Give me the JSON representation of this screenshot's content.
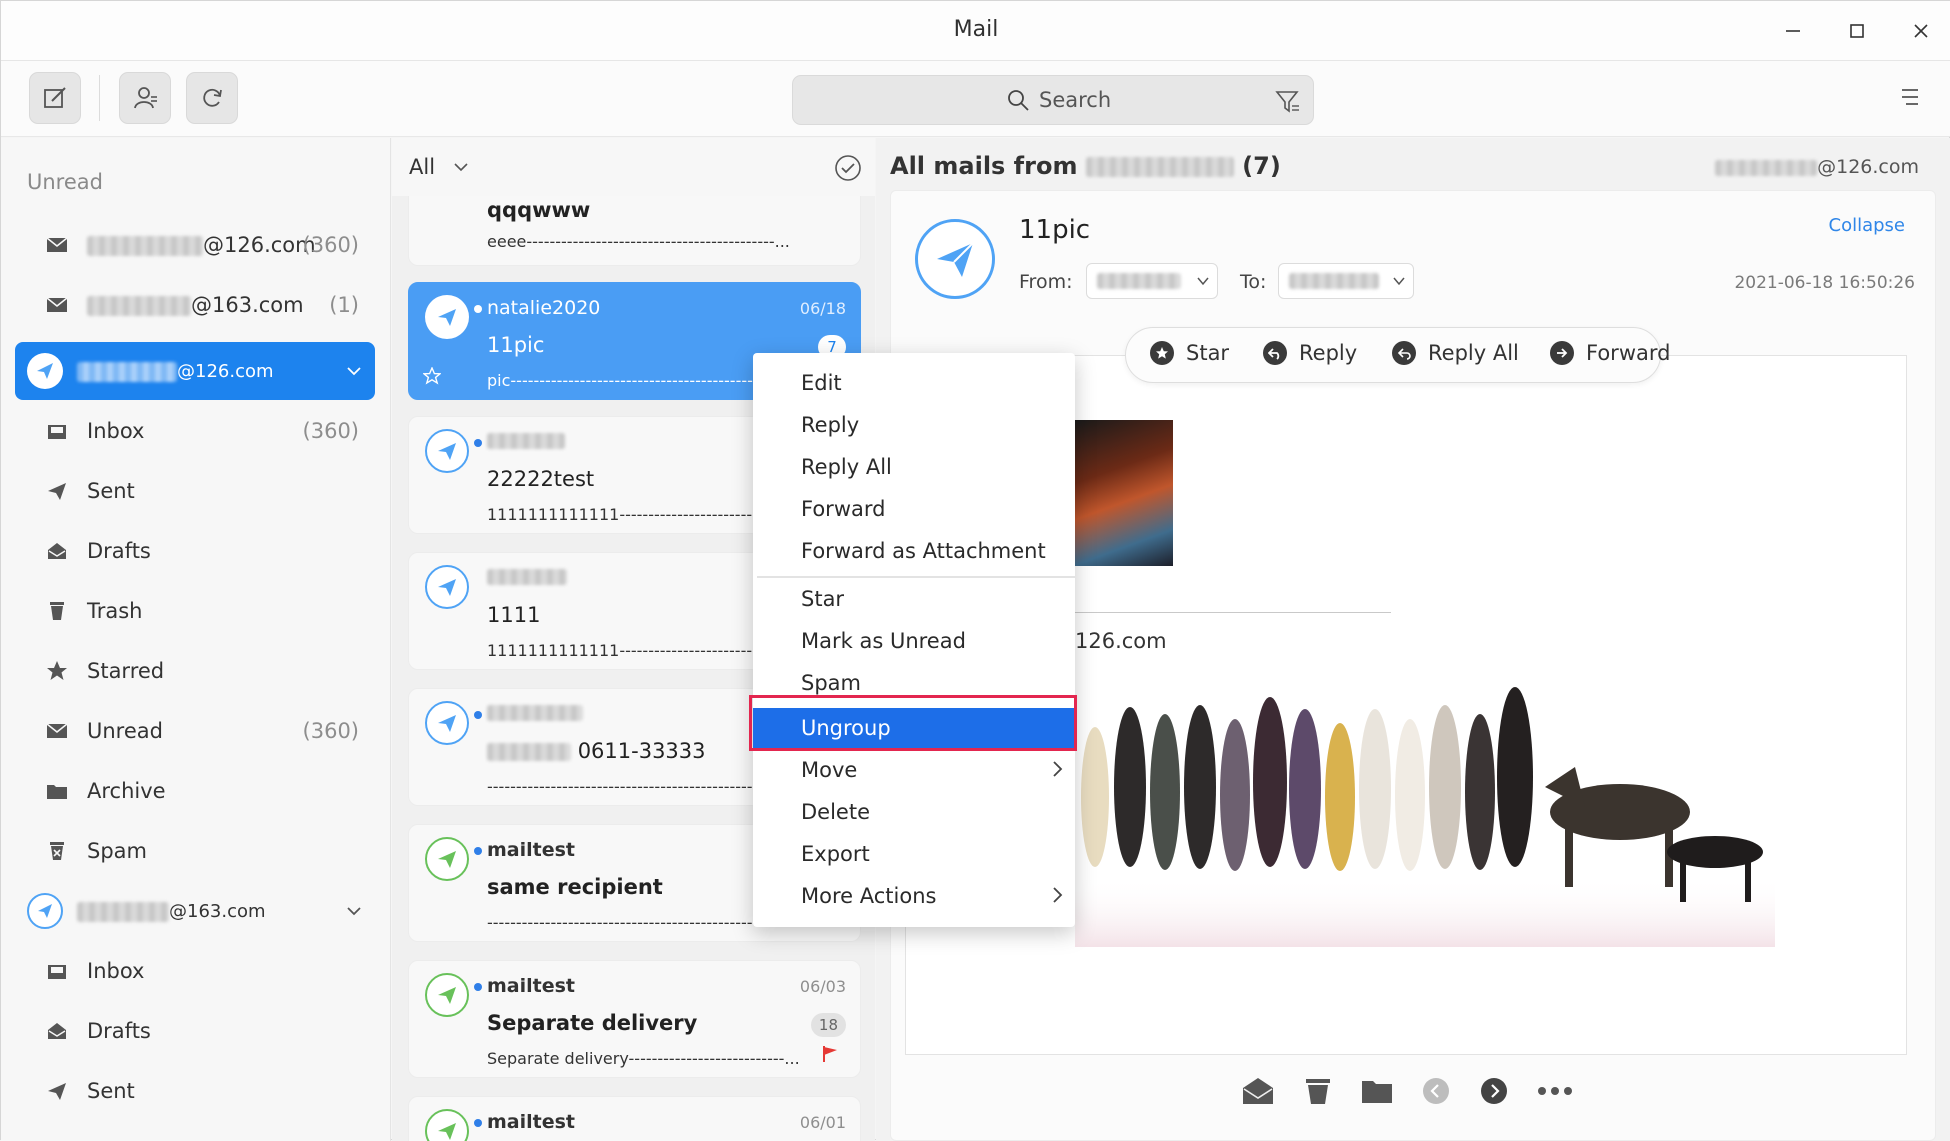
{
  "window": {
    "title": "Mail"
  },
  "toolbar": {
    "search_placeholder": "Search"
  },
  "sidebar": {
    "section_label": "Unread",
    "unread_accounts": [
      {
        "suffix": "@126.com",
        "count": "(360)"
      },
      {
        "suffix": "@163.com",
        "count": "(1)"
      }
    ],
    "account1": {
      "suffix": "@126.com",
      "folders": [
        {
          "label": "Inbox",
          "count": "(360)"
        },
        {
          "label": "Sent",
          "count": ""
        },
        {
          "label": "Drafts",
          "count": ""
        },
        {
          "label": "Trash",
          "count": ""
        },
        {
          "label": "Starred",
          "count": ""
        },
        {
          "label": "Unread",
          "count": "(360)"
        },
        {
          "label": "Archive",
          "count": ""
        },
        {
          "label": "Spam",
          "count": ""
        }
      ]
    },
    "account2": {
      "suffix": "@163.com",
      "folders": [
        {
          "label": "Inbox"
        },
        {
          "label": "Drafts"
        },
        {
          "label": "Sent"
        }
      ]
    }
  },
  "maillist": {
    "filter": "All",
    "items": [
      {
        "from": "",
        "subject": "qqqwww",
        "preview": "eeee-------------------------------------------...",
        "date": "",
        "count": ""
      },
      {
        "from": "natalie2020",
        "subject": "11pic",
        "preview": "pic-------------------------------------------------...",
        "date": "06/18",
        "count": "7"
      },
      {
        "from": "",
        "subject": "22222test",
        "preview": "1111111111111-----------------------",
        "date": "",
        "count": ""
      },
      {
        "from": "",
        "subject": "1111",
        "preview": "1111111111111-----------------------",
        "date": "",
        "count": ""
      },
      {
        "from": "",
        "subject": "0611-33333",
        "preview": "------------------------------------------------",
        "date": "",
        "count": ""
      },
      {
        "from": "mailtest",
        "subject": "same recipient",
        "preview": "------------------------------------------------",
        "date": "",
        "count": ""
      },
      {
        "from": "mailtest",
        "subject": "Separate delivery",
        "preview": "Separate delivery---------------------------...",
        "date": "06/03",
        "count": "18"
      },
      {
        "from": "mailtest",
        "subject": "",
        "preview": "",
        "date": "06/01",
        "count": ""
      }
    ]
  },
  "reader": {
    "title_prefix": "All mails from",
    "title_count": "(7)",
    "address_suffix": "@126.com",
    "subject": "11pic",
    "collapse": "Collapse",
    "from_label": "From:",
    "to_label": "To:",
    "datetime": "2021-06-18 16:50:26",
    "actions": [
      "Star",
      "Reply",
      "Reply All",
      "Forward"
    ],
    "body_address": "126.com"
  },
  "context_menu": {
    "items": [
      "Edit",
      "Reply",
      "Reply All",
      "Forward",
      "Forward as Attachment",
      "Star",
      "Mark as Unread",
      "Spam",
      "Ungroup",
      "Move",
      "Delete",
      "Export",
      "More Actions"
    ],
    "highlighted": "Ungroup"
  },
  "colors": {
    "accent": "#1d83ee",
    "selected_card": "#4a9df4",
    "highlight_box": "#e3264f",
    "flag": "#e53935"
  }
}
